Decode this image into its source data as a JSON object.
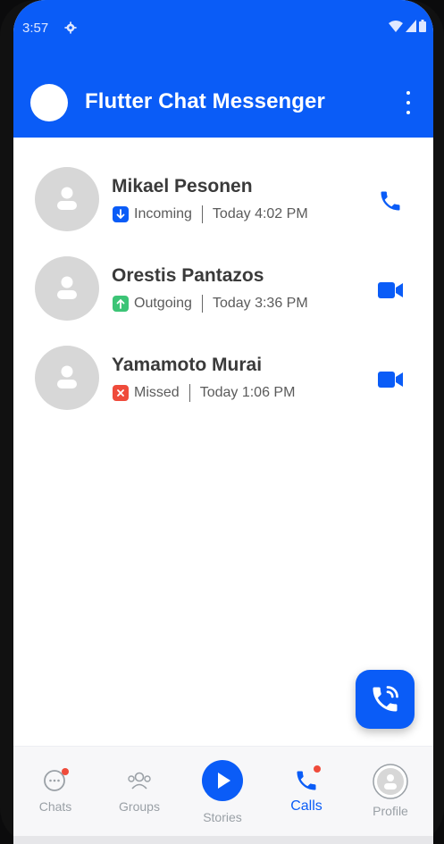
{
  "status_bar": {
    "time": "3:57"
  },
  "app_bar": {
    "title": "Flutter Chat Messenger"
  },
  "calls": [
    {
      "name": "Mikael Pesonen",
      "status": "Incoming",
      "time": "Today 4:02 PM",
      "status_color": "#0a5cf7",
      "action": "phone-icon"
    },
    {
      "name": "Orestis Pantazos",
      "status": "Outgoing",
      "time": "Today 3:36 PM",
      "status_color": "#3cc476",
      "action": "video-icon"
    },
    {
      "name": "Yamamoto Murai",
      "status": "Missed",
      "time": "Today 1:06 PM",
      "status_color": "#ef4b3b",
      "action": "video-icon"
    }
  ],
  "bottom_nav": {
    "chats": "Chats",
    "groups": "Groups",
    "stories": "Stories",
    "calls": "Calls",
    "profile": "Profile"
  },
  "colors": {
    "primary": "#0a5cf7",
    "badge": "#ef4b3b"
  }
}
